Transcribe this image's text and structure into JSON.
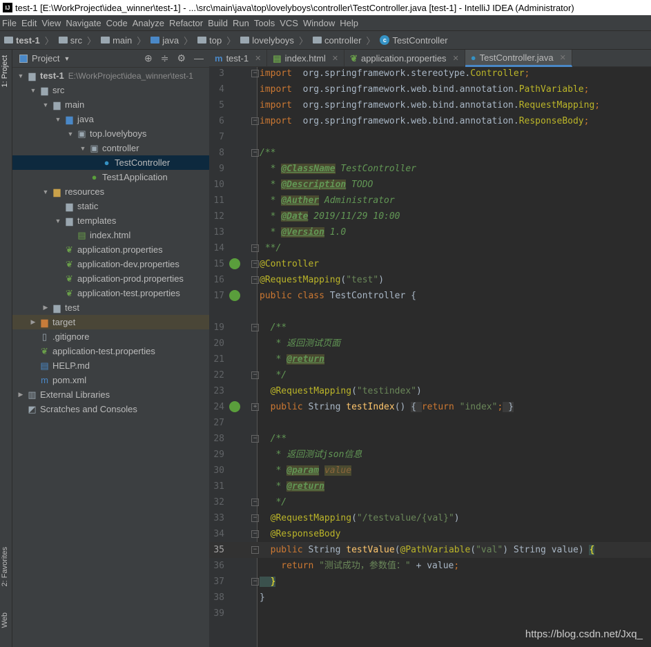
{
  "window": {
    "title": "test-1 [E:\\WorkProject\\idea_winner\\test-1] - ...\\src\\main\\java\\top\\lovelyboys\\controller\\TestController.java [test-1] - IntelliJ IDEA (Administrator)",
    "logo": "IJ"
  },
  "menu": [
    "File",
    "Edit",
    "View",
    "Navigate",
    "Code",
    "Analyze",
    "Refactor",
    "Build",
    "Run",
    "Tools",
    "VCS",
    "Window",
    "Help"
  ],
  "breadcrumb": [
    {
      "label": "test-1",
      "icon": "module-folder-icon"
    },
    {
      "label": "src",
      "icon": "folder-icon"
    },
    {
      "label": "main",
      "icon": "folder-icon"
    },
    {
      "label": "java",
      "icon": "source-folder-icon"
    },
    {
      "label": "top",
      "icon": "package-icon"
    },
    {
      "label": "lovelyboys",
      "icon": "package-icon"
    },
    {
      "label": "controller",
      "icon": "package-icon"
    },
    {
      "label": "TestController",
      "icon": "class-icon"
    }
  ],
  "side_tabs": {
    "project": "1: Project",
    "favorites": "2: Favorites",
    "web": "Web"
  },
  "project_panel": {
    "title": "Project",
    "tree": [
      {
        "label": "test-1",
        "path": "E:\\WorkProject\\idea_winner\\test-1",
        "level": 0,
        "state": "open",
        "icon": "module"
      },
      {
        "label": "src",
        "level": 1,
        "state": "open",
        "icon": "folder"
      },
      {
        "label": "main",
        "level": 2,
        "state": "open",
        "icon": "folder"
      },
      {
        "label": "java",
        "level": 3,
        "state": "open",
        "icon": "srcfolder"
      },
      {
        "label": "top.lovelyboys",
        "level": 4,
        "state": "open",
        "icon": "package"
      },
      {
        "label": "controller",
        "level": 5,
        "state": "open",
        "icon": "package"
      },
      {
        "label": "TestController",
        "level": 6,
        "state": "none",
        "icon": "class",
        "selected": true
      },
      {
        "label": "Test1Application",
        "level": 5,
        "state": "none",
        "icon": "springclass"
      },
      {
        "label": "resources",
        "level": 2,
        "state": "open",
        "icon": "resfolder"
      },
      {
        "label": "static",
        "level": 3,
        "state": "none",
        "icon": "folder"
      },
      {
        "label": "templates",
        "level": 3,
        "state": "open",
        "icon": "folder"
      },
      {
        "label": "index.html",
        "level": 4,
        "state": "none",
        "icon": "html"
      },
      {
        "label": "application.properties",
        "level": 3,
        "state": "none",
        "icon": "props"
      },
      {
        "label": "application-dev.properties",
        "level": 3,
        "state": "none",
        "icon": "props"
      },
      {
        "label": "application-prod.properties",
        "level": 3,
        "state": "none",
        "icon": "props"
      },
      {
        "label": "application-test.properties",
        "level": 3,
        "state": "none",
        "icon": "props"
      },
      {
        "label": "test",
        "level": 2,
        "state": "closed",
        "icon": "folder"
      },
      {
        "label": "target",
        "level": 1,
        "state": "closed",
        "icon": "excluded",
        "highlight": true
      },
      {
        "label": ".gitignore",
        "level": 1,
        "state": "none",
        "icon": "file"
      },
      {
        "label": "application-test.properties",
        "level": 1,
        "state": "none",
        "icon": "props"
      },
      {
        "label": "HELP.md",
        "level": 1,
        "state": "none",
        "icon": "md"
      },
      {
        "label": "pom.xml",
        "level": 1,
        "state": "none",
        "icon": "maven"
      },
      {
        "label": "External Libraries",
        "level": 0,
        "state": "closed",
        "icon": "libs"
      },
      {
        "label": "Scratches and Consoles",
        "level": 0,
        "state": "none",
        "icon": "scratch"
      }
    ]
  },
  "tabs": [
    {
      "label": "test-1",
      "icon": "maven-icon",
      "active": false
    },
    {
      "label": "index.html",
      "icon": "html-icon",
      "active": false
    },
    {
      "label": "application.properties",
      "icon": "spring-properties-icon",
      "active": false
    },
    {
      "label": "TestController.java",
      "icon": "class-icon",
      "active": true
    }
  ],
  "code": [
    {
      "n": "3",
      "fold": "-",
      "t": [
        [
          "kw",
          "import"
        ],
        [
          "",
          "  org.springframework.stereotype."
        ],
        [
          "impc",
          "Controller"
        ],
        [
          "kw",
          ";"
        ]
      ]
    },
    {
      "n": "4",
      "t": [
        [
          "kw",
          "import"
        ],
        [
          "",
          "  org.springframework.web.bind.annotation."
        ],
        [
          "impc",
          "PathVariable"
        ],
        [
          "kw",
          ";"
        ]
      ]
    },
    {
      "n": "5",
      "t": [
        [
          "kw",
          "import"
        ],
        [
          "",
          "  org.springframework.web.bind.annotation."
        ],
        [
          "impc",
          "RequestMapping"
        ],
        [
          "kw",
          ";"
        ]
      ]
    },
    {
      "n": "6",
      "fold": "-",
      "t": [
        [
          "kw",
          "import"
        ],
        [
          "",
          "  org.springframework.web.bind.annotation."
        ],
        [
          "impc",
          "ResponseBody"
        ],
        [
          "kw",
          ";"
        ]
      ]
    },
    {
      "n": "7",
      "t": []
    },
    {
      "n": "8",
      "fold": "-",
      "t": [
        [
          "doc",
          "/**"
        ]
      ]
    },
    {
      "n": "9",
      "t": [
        [
          "doc",
          "  * "
        ],
        [
          "tag",
          "@ClassName"
        ],
        [
          "doc",
          " TestController"
        ]
      ]
    },
    {
      "n": "10",
      "t": [
        [
          "doc",
          "  * "
        ],
        [
          "tag",
          "@Description"
        ],
        [
          "doc",
          " TODO"
        ]
      ]
    },
    {
      "n": "11",
      "t": [
        [
          "doc",
          "  * "
        ],
        [
          "tag",
          "@Auther"
        ],
        [
          "doc",
          " Administrator"
        ]
      ]
    },
    {
      "n": "12",
      "t": [
        [
          "doc",
          "  * "
        ],
        [
          "tag",
          "@Date"
        ],
        [
          "doc",
          " 2019/11/29 10:00"
        ]
      ]
    },
    {
      "n": "13",
      "t": [
        [
          "doc",
          "  * "
        ],
        [
          "tag",
          "@Version"
        ],
        [
          "doc",
          " 1.0"
        ]
      ]
    },
    {
      "n": "14",
      "fold": "-",
      "t": [
        [
          "doc",
          " **/"
        ]
      ]
    },
    {
      "n": "15",
      "fold": "-",
      "gutter": "spring-bean-icon",
      "t": [
        [
          "ann",
          "@Controller"
        ]
      ]
    },
    {
      "n": "16",
      "fold": "-",
      "t": [
        [
          "ann",
          "@RequestMapping"
        ],
        [
          "",
          "("
        ],
        [
          "str",
          "\"test\""
        ],
        [
          "",
          ")"
        ]
      ]
    },
    {
      "n": "17",
      "gutter": "spring-class-icon",
      "t": [
        [
          "kw",
          "public class "
        ],
        [
          "",
          "TestController {"
        ]
      ]
    },
    {
      "n": "",
      "t": []
    },
    {
      "n": "19",
      "fold": "-",
      "t": [
        [
          "doc",
          "  /**"
        ]
      ]
    },
    {
      "n": "20",
      "t": [
        [
          "doc",
          "   * 返回测试页面"
        ]
      ]
    },
    {
      "n": "21",
      "t": [
        [
          "doc",
          "   * "
        ],
        [
          "tag",
          "@return"
        ]
      ]
    },
    {
      "n": "22",
      "fold": "-",
      "t": [
        [
          "doc",
          "   */"
        ]
      ]
    },
    {
      "n": "23",
      "t": [
        [
          "ann",
          "  @RequestMapping"
        ],
        [
          "",
          "("
        ],
        [
          "str",
          "\"testindex\""
        ],
        [
          "",
          ")"
        ]
      ]
    },
    {
      "n": "24",
      "fold": "+",
      "gutter": "spring-web-icon",
      "t": [
        [
          "kw",
          "  public "
        ],
        [
          "",
          "String "
        ],
        [
          "fn",
          "testIndex"
        ],
        [
          "",
          "() "
        ],
        [
          "fld",
          "{ "
        ],
        [
          "kw",
          "return "
        ],
        [
          "str",
          "\"index\""
        ],
        [
          "kw",
          ";"
        ],
        [
          "fld",
          " }"
        ]
      ]
    },
    {
      "n": "27",
      "t": []
    },
    {
      "n": "28",
      "fold": "-",
      "t": [
        [
          "doc",
          "  /**"
        ]
      ]
    },
    {
      "n": "29",
      "t": [
        [
          "doc",
          "   * 返回测试json信息"
        ]
      ]
    },
    {
      "n": "30",
      "t": [
        [
          "doc",
          "   * "
        ],
        [
          "tag",
          "@param"
        ],
        [
          "doc",
          " "
        ],
        [
          "dval",
          "value"
        ]
      ]
    },
    {
      "n": "31",
      "t": [
        [
          "doc",
          "   * "
        ],
        [
          "tag",
          "@return"
        ]
      ]
    },
    {
      "n": "32",
      "fold": "-",
      "t": [
        [
          "doc",
          "   */"
        ]
      ]
    },
    {
      "n": "33",
      "fold": "-",
      "t": [
        [
          "ann",
          "  @RequestMapping"
        ],
        [
          "",
          "("
        ],
        [
          "str",
          "\"/testvalue/{val}\""
        ],
        [
          "",
          ")"
        ]
      ]
    },
    {
      "n": "34",
      "fold": "-",
      "t": [
        [
          "ann",
          "  @ResponseBody"
        ]
      ]
    },
    {
      "n": "35",
      "fold": "-",
      "current": true,
      "t": [
        [
          "kw",
          "  public "
        ],
        [
          "",
          "String "
        ],
        [
          "fn",
          "testValue"
        ],
        [
          "",
          "("
        ],
        [
          "ann",
          "@PathVariable"
        ],
        [
          "",
          "("
        ],
        [
          "str",
          "\"val\""
        ],
        [
          "",
          ") String value) "
        ],
        [
          "brace",
          "{"
        ]
      ]
    },
    {
      "n": "36",
      "t": [
        [
          "kw",
          "    return "
        ],
        [
          "str",
          "\"测试成功，参数值：\""
        ],
        [
          "",
          " + value"
        ],
        [
          "kw",
          ";"
        ]
      ]
    },
    {
      "n": "37",
      "fold": "-",
      "t": [
        [
          "brace",
          "  }"
        ]
      ]
    },
    {
      "n": "38",
      "t": [
        [
          "",
          "}"
        ]
      ]
    },
    {
      "n": "39",
      "t": []
    }
  ],
  "watermark": "https://blog.csdn.net/Jxq_",
  "colors": {
    "keyword": "#cc7832",
    "string": "#6a8759",
    "annotation": "#bbb529",
    "doc": "#629755",
    "accent": "#4a88c7"
  }
}
